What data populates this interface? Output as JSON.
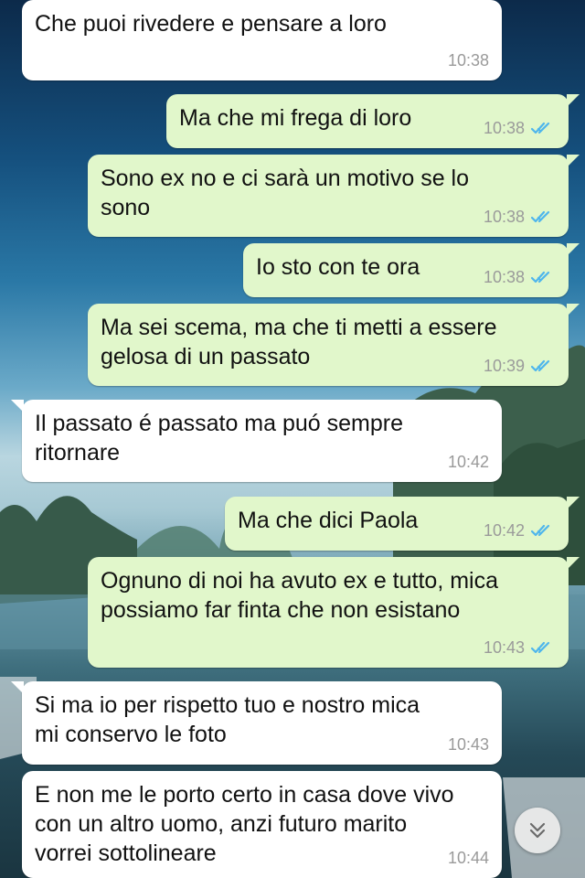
{
  "colors": {
    "incoming_bubble": "#ffffff",
    "outgoing_bubble": "#e1f7cb",
    "timestamp": "#9a9a9a",
    "read_ticks": "#4fb6ec"
  },
  "messages": [
    {
      "direction": "in",
      "text": "Che puoi rivedere e pensare a loro",
      "time": "10:38"
    },
    {
      "direction": "out",
      "text": "Ma che mi frega di loro",
      "time": "10:38",
      "status": "read-double-check-icon"
    },
    {
      "direction": "out",
      "text": "Sono ex no e ci sarà un motivo se lo\nsono",
      "time": "10:38",
      "status": "read-double-check-icon"
    },
    {
      "direction": "out",
      "text": "Io sto con te ora",
      "time": "10:38",
      "status": "read-double-check-icon"
    },
    {
      "direction": "out",
      "text": "Ma sei scema, ma che ti metti a essere\ngelosa di un passato",
      "time": "10:39",
      "status": "read-double-check-icon"
    },
    {
      "direction": "in",
      "text": "Il passato é passato ma puó sempre\nritornare",
      "time": "10:42"
    },
    {
      "direction": "out",
      "text": "Ma che dici Paola",
      "time": "10:42",
      "status": "read-double-check-icon"
    },
    {
      "direction": "out",
      "text": "Ognuno di noi ha avuto ex e tutto, mica\npossiamo far finta che non esistano",
      "time": "10:43",
      "status": "read-double-check-icon"
    },
    {
      "direction": "in",
      "text": "Si ma io per rispetto tuo e nostro mica\nmi conservo le foto",
      "time": "10:43"
    },
    {
      "direction": "in",
      "text": "E non me le porto certo in casa dove vivo\ncon un altro uomo, anzi futuro marito\nvorrei sottolineare",
      "time": "10:44"
    }
  ],
  "scroll_button": {
    "icon": "double-chevron-down-icon"
  }
}
